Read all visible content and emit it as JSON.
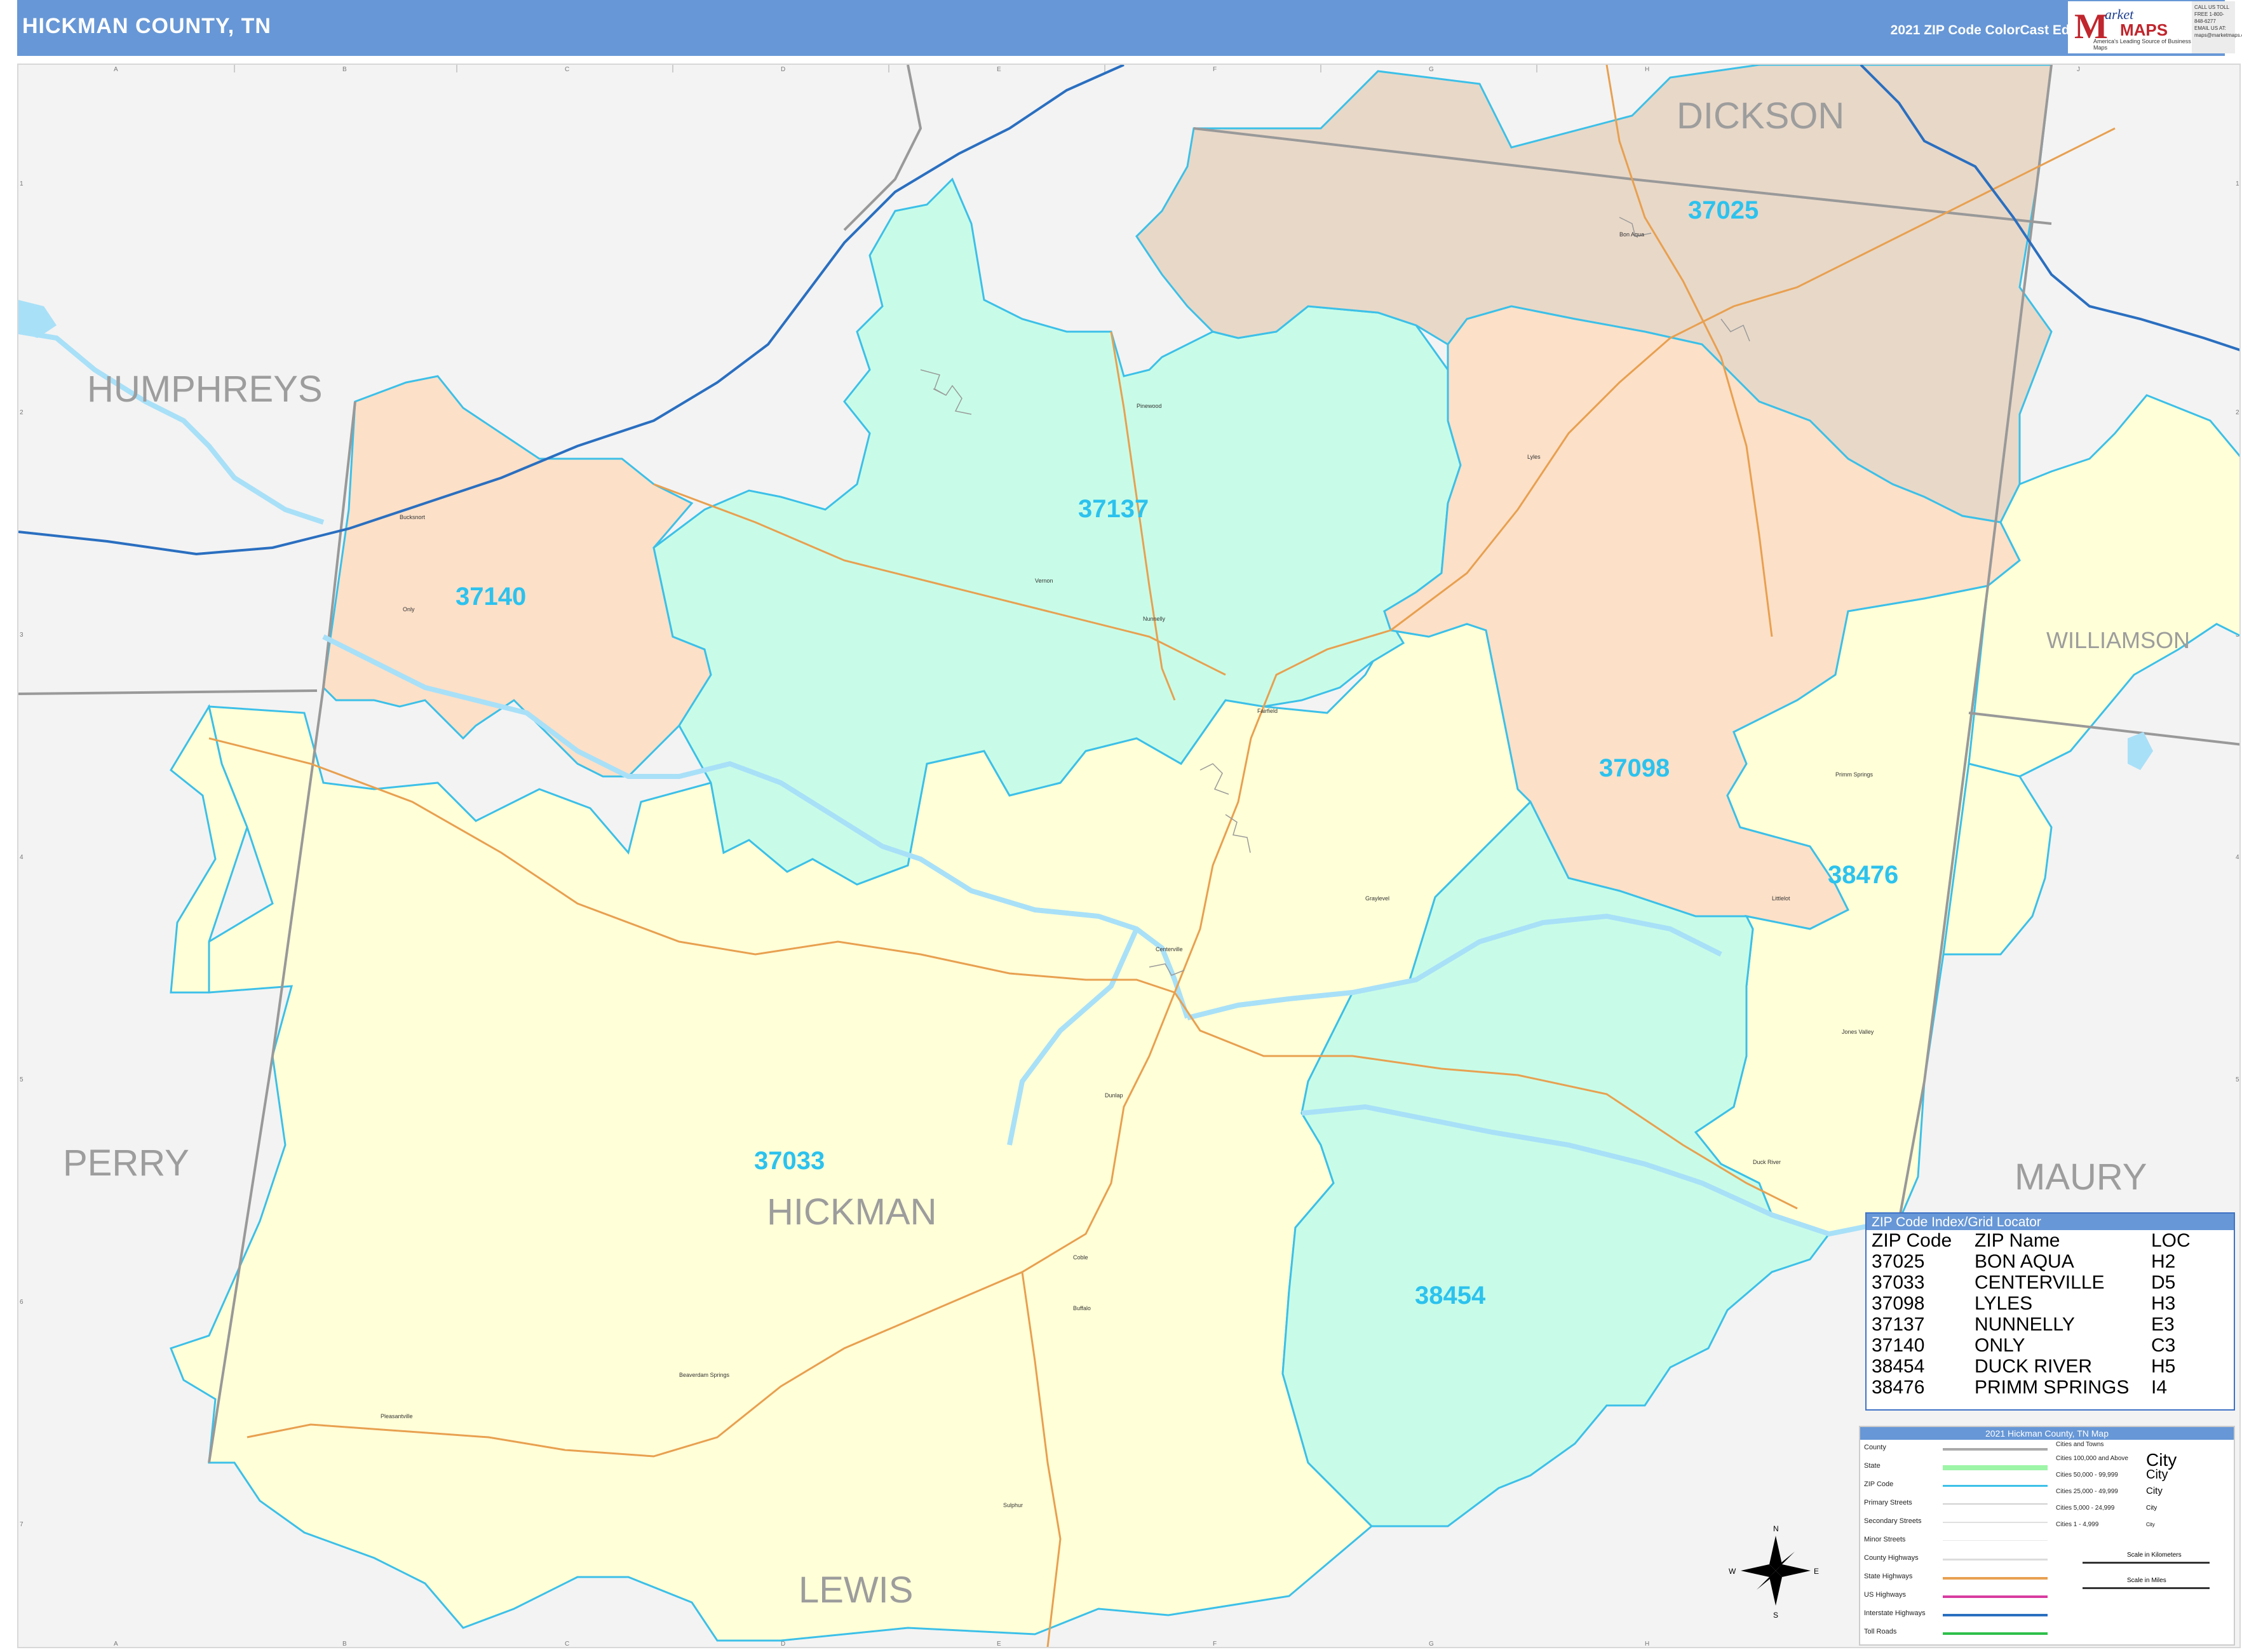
{
  "header": {
    "title": "HICKMAN COUNTY, TN",
    "edition": "2021 ZIP Code ColorCast Edition",
    "logo_m": "M",
    "logo_market": "arket",
    "logo_maps": "MAPS",
    "logo_tagline": "America's Leading Source of Business Maps",
    "contact": "CALL US TOLL FREE 1-800-848-6277 EMAIL US AT: maps@marketmaps.com"
  },
  "grid": {
    "columns": [
      "A",
      "B",
      "C",
      "D",
      "E",
      "F",
      "G",
      "H",
      "I",
      "J"
    ],
    "rows": [
      "1",
      "2",
      "3",
      "4",
      "5",
      "6",
      "7"
    ]
  },
  "counties": {
    "dickson": "DICKSON",
    "humphreys": "HUMPHREYS",
    "williamson": "WILLIAMSON",
    "perry": "PERRY",
    "maury": "MAURY",
    "hickman": "HICKMAN",
    "lewis": "LEWIS"
  },
  "zip_labels": {
    "z37025": "37025",
    "z37137": "37137",
    "z37140": "37140",
    "z37098": "37098",
    "z38476": "38476",
    "z37033": "37033",
    "z38454": "38454"
  },
  "places": {
    "bon_aqua": "Bon Aqua",
    "pinewood": "Pinewood",
    "bucksnort": "Bucksnort",
    "only": "Only",
    "vernon": "Vernon",
    "nunnelly": "Nunnelly",
    "fairfield": "Fairfield",
    "lyles": "Lyles",
    "primm_springs": "Primm Springs",
    "littlelot": "Littlelot",
    "graylevel": "Graylevel",
    "centerville": "Centerville",
    "jones_valley": "Jones Valley",
    "duck_river": "Duck River",
    "dunlap": "Dunlap",
    "coble": "Coble",
    "buffalo": "Buffalo",
    "beaverdam_springs": "Beaverdam Springs",
    "pleasantville": "Pleasantville",
    "sulphur": "Sulphur"
  },
  "zip_index": {
    "title": "ZIP Code Index/Grid Locator",
    "headers": [
      "ZIP Code",
      "ZIP Name",
      "LOC"
    ],
    "rows": [
      [
        "37025",
        "BON AQUA",
        "H2"
      ],
      [
        "37033",
        "CENTERVILLE",
        "D5"
      ],
      [
        "37098",
        "LYLES",
        "H3"
      ],
      [
        "37137",
        "NUNNELLY",
        "E3"
      ],
      [
        "37140",
        "ONLY",
        "C3"
      ],
      [
        "38454",
        "DUCK RIVER",
        "H5"
      ],
      [
        "38476",
        "PRIMM SPRINGS",
        "I4"
      ]
    ]
  },
  "legend": {
    "title": "2021 Hickman County, TN Map",
    "rows": [
      "County",
      "State",
      "ZIP Code",
      "Primary Streets",
      "Secondary Streets",
      "Minor Streets",
      "County Highways",
      "State Highways",
      "US Highways",
      "Interstate Highways",
      "Toll Roads"
    ],
    "cities_title": "Cities and Towns",
    "cities": [
      [
        "Cities 100,000 and Above",
        "City"
      ],
      [
        "Cities 50,000 - 99,999",
        "City"
      ],
      [
        "Cities 25,000 - 49,999",
        "City"
      ],
      [
        "Cities 5,000 - 24,999",
        "City"
      ],
      [
        "Cities 1 - 4,999",
        "City"
      ]
    ],
    "scale_km": "Scale in Kilometers",
    "scale_mi": "Scale in Miles",
    "compass": [
      "N",
      "E",
      "S",
      "W"
    ]
  },
  "colors": {
    "header": "#6797d6",
    "yellow_zip": "#ffffd8",
    "cyan_zip": "#c8fce8",
    "peach_zip": "#fce0c8",
    "tan_zip": "#e8d8c8",
    "zip_border": "#3cc0e8",
    "interstate": "#2a6fc0",
    "water": "#a8e0f8"
  }
}
